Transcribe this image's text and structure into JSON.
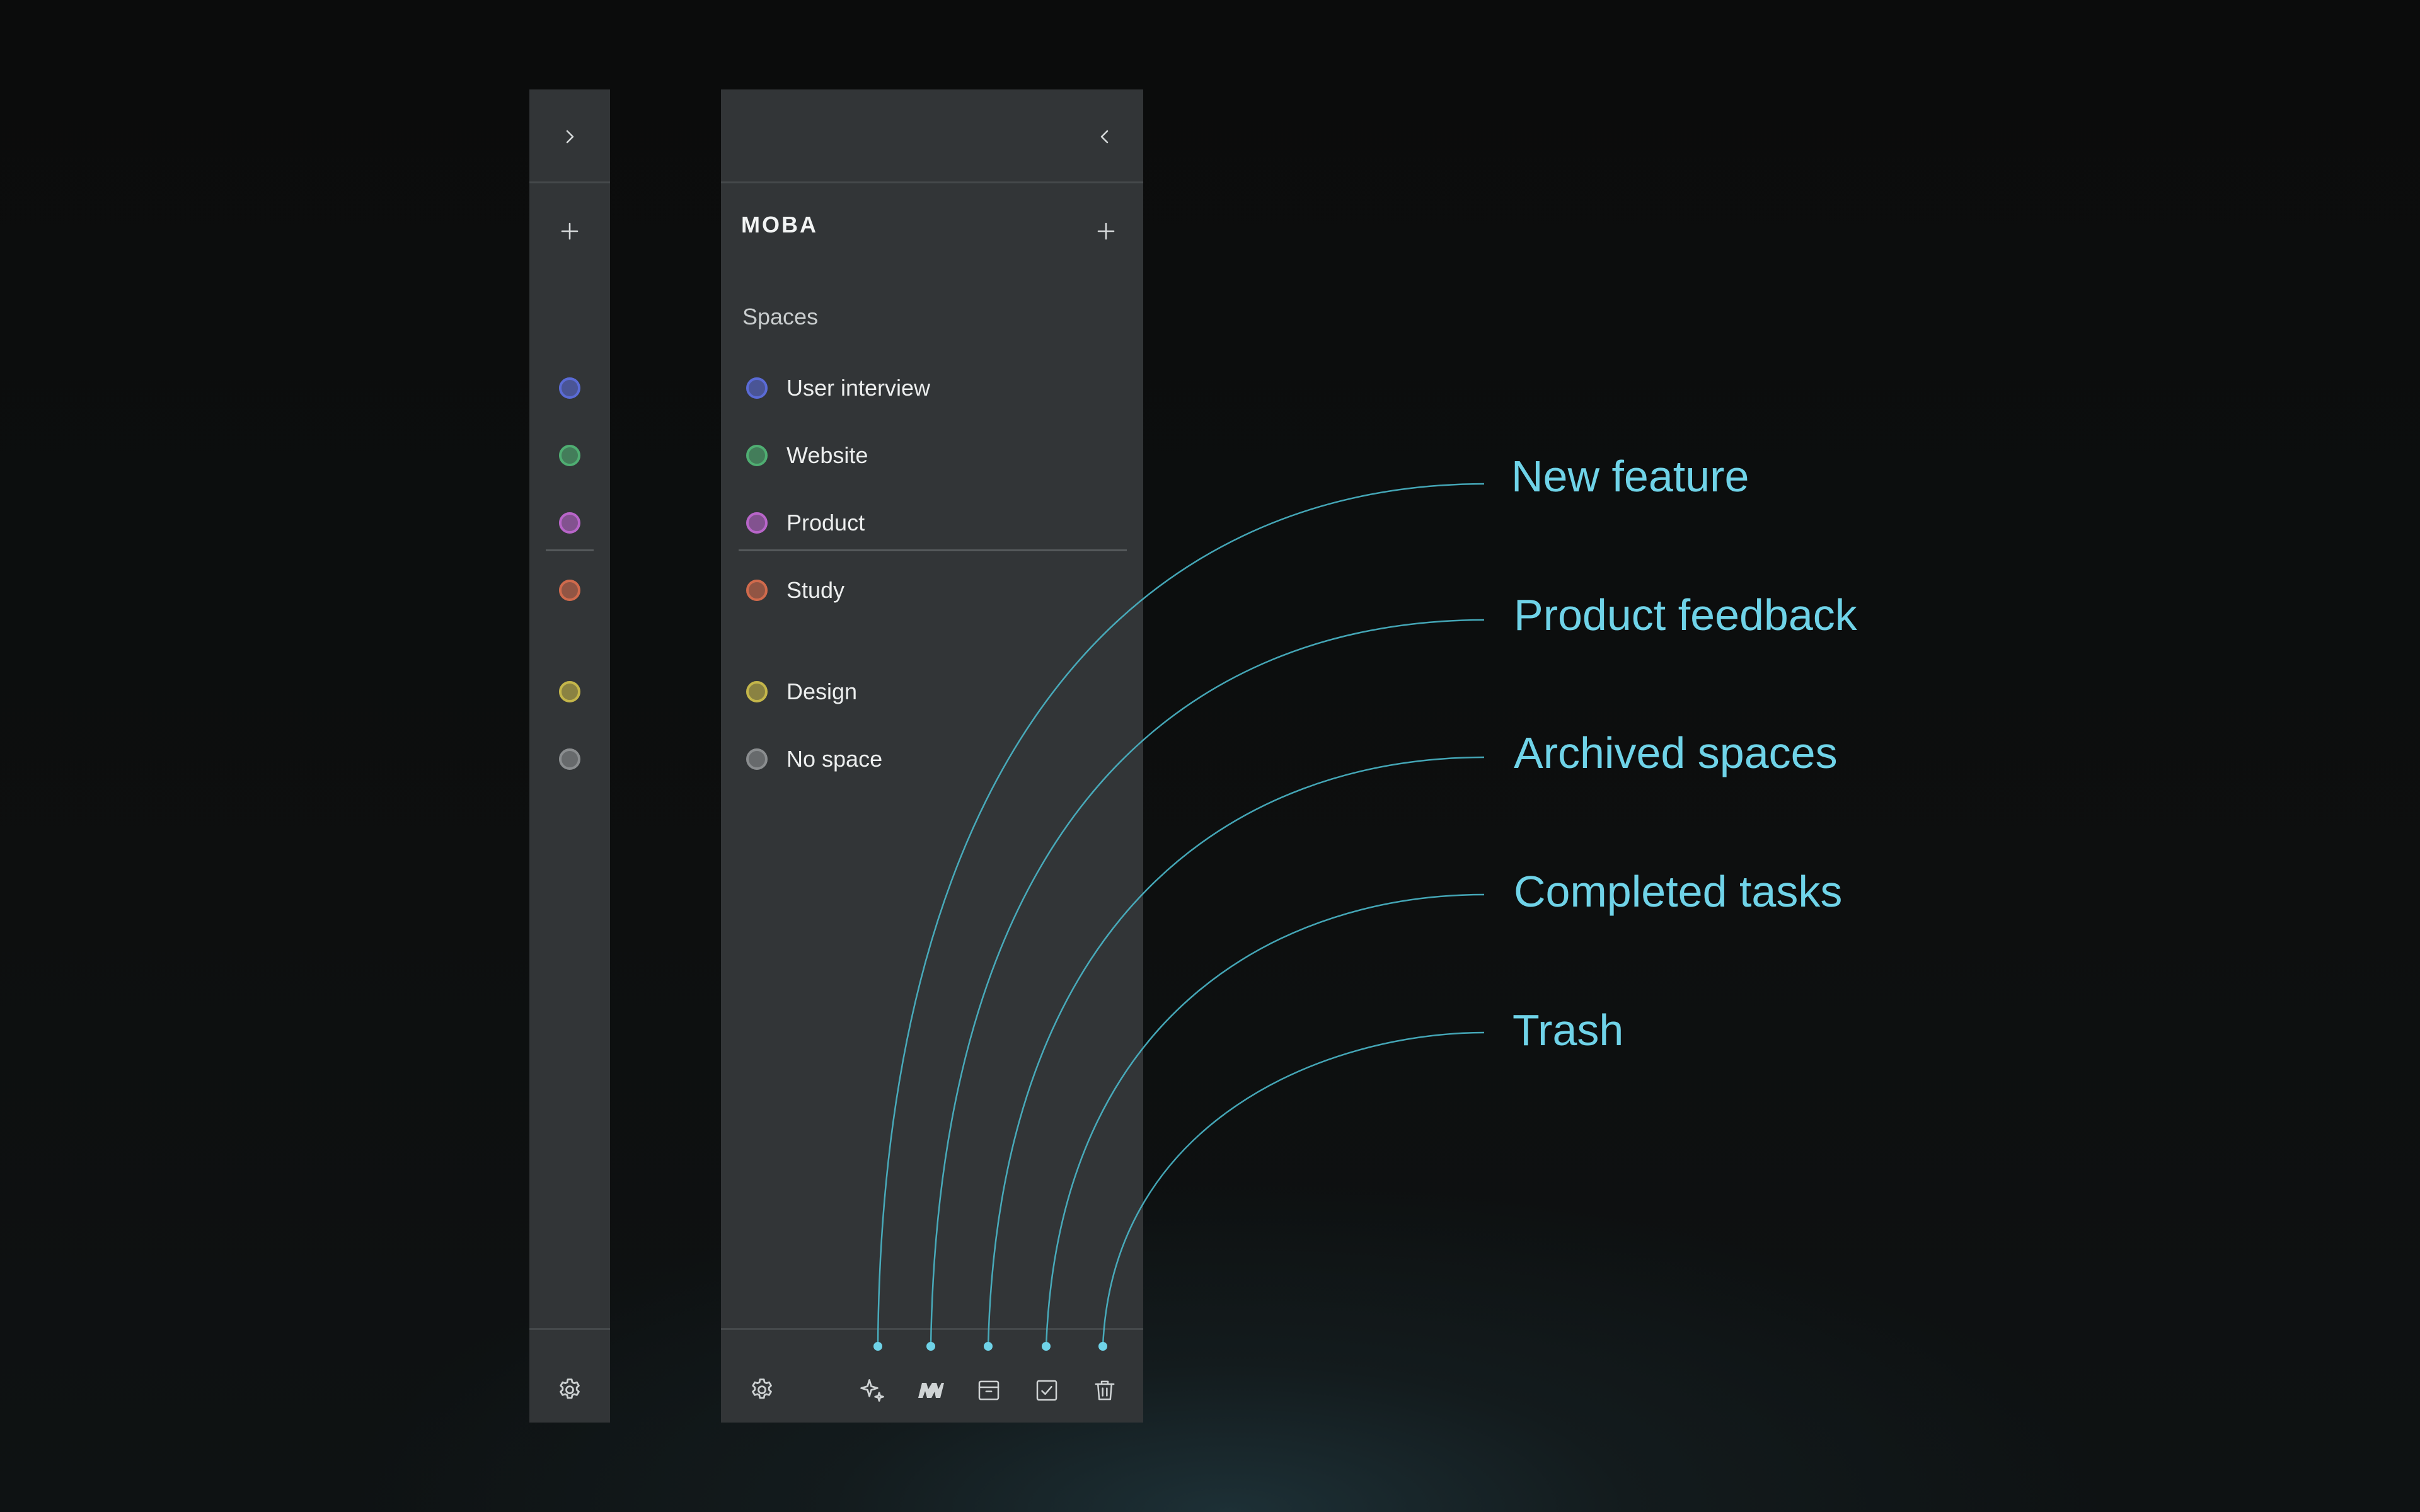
{
  "app": {
    "brand": "MOBA"
  },
  "colors": {
    "accent": "#6fd3e8",
    "panel_bg": "#323537",
    "divider": "#45494b"
  },
  "collapsed_sidebar": {
    "expand_icon": "chevron-right-icon",
    "add_icon": "plus-icon",
    "settings_icon": "gear-icon",
    "space_dots": [
      {
        "color": "#5a6bd6"
      },
      {
        "color": "#4fae72"
      },
      {
        "color": "#b865c9"
      },
      {
        "color": "#d06a4c"
      },
      {
        "color": "#c4b64a"
      },
      {
        "color": "#8a8d8f"
      }
    ]
  },
  "sidebar": {
    "collapse_icon": "chevron-left-icon",
    "spaces_label": "Spaces",
    "add_icon": "plus-icon",
    "spaces": [
      {
        "label": "User interview",
        "color": "#5a6bd6"
      },
      {
        "label": "Website",
        "color": "#4fae72"
      },
      {
        "label": "Product",
        "color": "#b865c9"
      },
      {
        "label": "Study",
        "color": "#d06a4c"
      }
    ],
    "other_spaces": [
      {
        "label": "Design",
        "color": "#c4b64a"
      },
      {
        "label": "No space",
        "color": "#8a8d8f"
      }
    ],
    "footer": {
      "settings_icon": "gear-icon",
      "tools": [
        {
          "icon": "sparkle-icon",
          "callout": "New feature"
        },
        {
          "icon": "feedback-logo-icon",
          "callout": "Product feedback"
        },
        {
          "icon": "archive-icon",
          "callout": "Archived spaces"
        },
        {
          "icon": "checkbox-icon",
          "callout": "Completed tasks"
        },
        {
          "icon": "trash-icon",
          "callout": "Trash"
        }
      ]
    }
  }
}
